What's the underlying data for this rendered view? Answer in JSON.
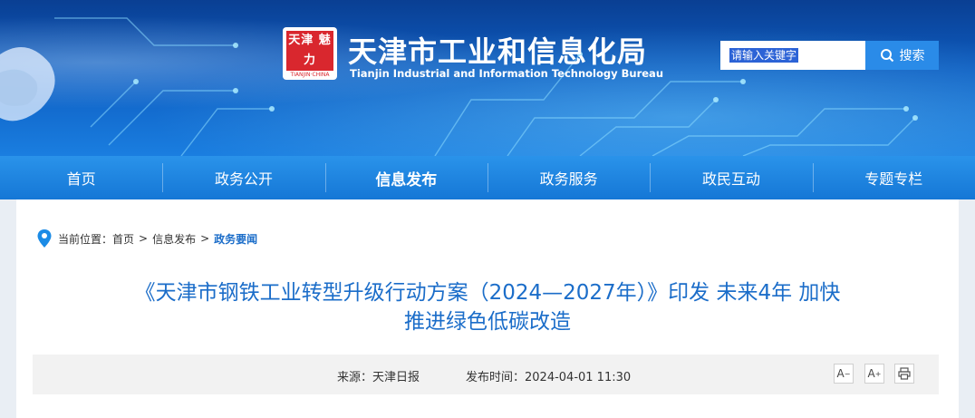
{
  "header": {
    "org_name": "天津市工业和信息化局",
    "org_name_en": "Tianjin Industrial and Information Technology Bureau",
    "seal_text": "天津 魅力",
    "seal_subtext": "TIANJIN·CHINA"
  },
  "search": {
    "placeholder": "请输入关键字",
    "button_label": "搜索",
    "icon": "search-icon"
  },
  "nav": {
    "items": [
      {
        "label": "首页"
      },
      {
        "label": "政务公开"
      },
      {
        "label": "信息发布",
        "active": true
      },
      {
        "label": "政务服务"
      },
      {
        "label": "政民互动"
      },
      {
        "label": "专题专栏"
      }
    ]
  },
  "breadcrumb": {
    "prefix": "当前位置：",
    "items": [
      "首页",
      "信息发布",
      "政务要闻"
    ],
    "separator": ">",
    "icon": "location-pin-icon"
  },
  "article": {
    "title_line1": "《天津市钢铁工业转型升级行动方案（2024—2027年）》印发 未来4年 加快",
    "title_line2": "推进绿色低碳改造",
    "source": "来源：天津日报",
    "published": "发布时间：2024-04-01 11:30"
  },
  "tools": {
    "font_decrease": "A",
    "font_increase": "A",
    "print_icon": "print-icon"
  },
  "colors": {
    "banner": "#0d5cc0",
    "nav": "#1d80de",
    "title": "#1b6dc9",
    "seal": "#d9272e"
  }
}
